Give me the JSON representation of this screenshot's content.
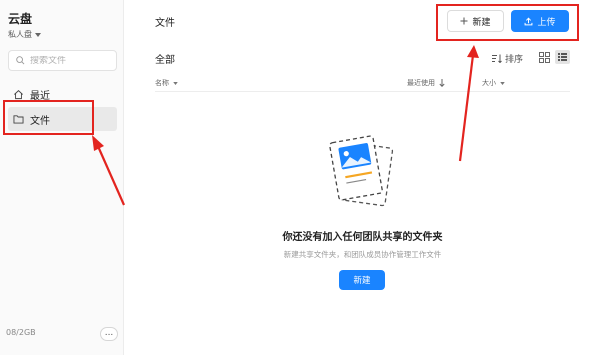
{
  "sidebar": {
    "brand": "云盘",
    "space_label": "私人盘",
    "search_placeholder": "搜索文件",
    "items": [
      {
        "label": "最近",
        "icon": "home-icon"
      },
      {
        "label": "文件",
        "icon": "folder-icon",
        "selected": true
      }
    ],
    "storage": "08/2GB",
    "more_label": "..."
  },
  "header": {
    "title": "文件",
    "new_label": "新建",
    "upload_label": "上传"
  },
  "main": {
    "section_title": "全部",
    "sort_label": "排序",
    "columns": [
      "名称",
      "最近使用",
      "大小"
    ],
    "empty": {
      "title": "你还没有加入任何团队共享的文件夹",
      "description": "新建共享文件夹，和团队成员协作管理工作文件",
      "button_label": "新建"
    }
  },
  "colors": {
    "accent": "#1a84ff",
    "annotation": "#e3241f",
    "selected_bg": "#e9e9e9"
  }
}
